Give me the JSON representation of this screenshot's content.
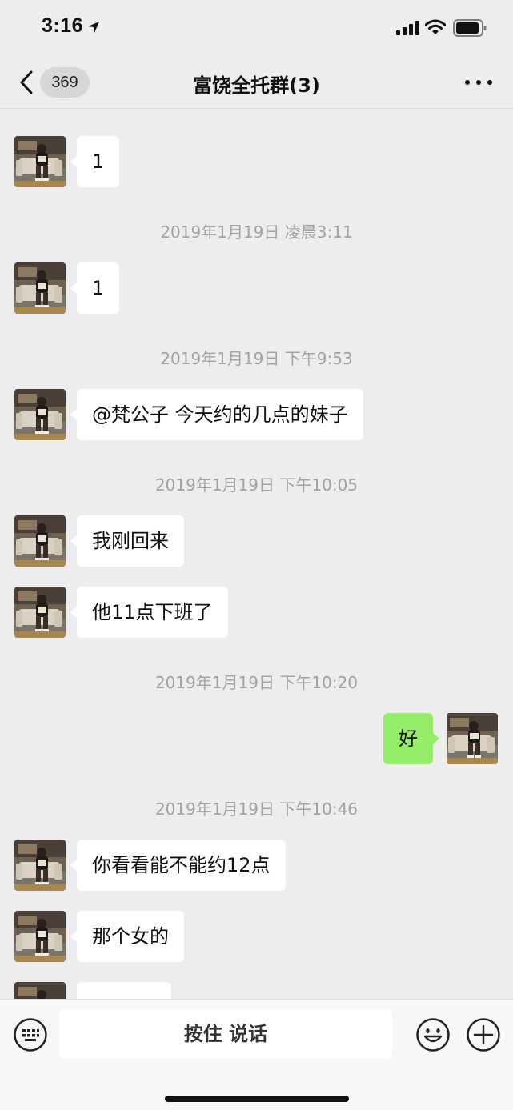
{
  "status_bar": {
    "time": "3:16"
  },
  "nav": {
    "unread_count": "369",
    "title": "富饶全托群(3)"
  },
  "messages": [
    {
      "kind": "in",
      "text": "1"
    },
    {
      "kind": "time",
      "text": "2019年1月19日 凌晨3:11"
    },
    {
      "kind": "in",
      "text": "1"
    },
    {
      "kind": "time",
      "text": "2019年1月19日 下午9:53"
    },
    {
      "kind": "in",
      "text": "@梵公子 今天约的几点的妹子"
    },
    {
      "kind": "time",
      "text": "2019年1月19日 下午10:05"
    },
    {
      "kind": "in",
      "text": "我刚回来"
    },
    {
      "kind": "in",
      "text": "他11点下班了"
    },
    {
      "kind": "time",
      "text": "2019年1月19日 下午10:20"
    },
    {
      "kind": "out",
      "text": "好"
    },
    {
      "kind": "time",
      "text": "2019年1月19日 下午10:46"
    },
    {
      "kind": "in",
      "text": "你看看能不能约12点"
    },
    {
      "kind": "in",
      "text": "那个女的"
    },
    {
      "kind": "in",
      "text": ""
    }
  ],
  "input_bar": {
    "hold_to_talk_label": "按住 说话"
  },
  "colors": {
    "outgoing_bubble": "#95ec69",
    "incoming_bubble": "#ffffff",
    "chat_background": "#ededed"
  }
}
